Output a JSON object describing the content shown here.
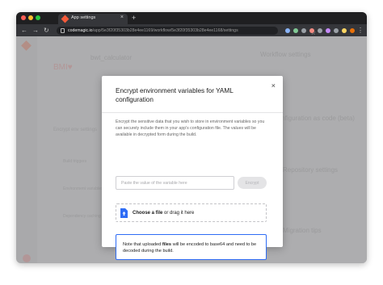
{
  "browser": {
    "tab_title": "App settings",
    "tab_close": "×",
    "new_tab": "+",
    "url_host": "codemagic.io",
    "url_path": "/app/5e3f20f35303b28e4ee1169/workflow/5e3f20f35303b28e4ee1168/settings",
    "nav": {
      "back": "←",
      "forward": "→",
      "reload": "↻"
    },
    "star": "☆",
    "menu": "⋮"
  },
  "background": {
    "app_name": "bwt_calculator",
    "workflow_settings": "Workflow settings",
    "encrypt_title": "Encrypt env settings",
    "build_triggers": "Build triggers",
    "environment": "Environment variables",
    "dependency_caching": "Dependency caching",
    "config_as_code": "Configuration as code (beta)",
    "repo_settings": "Repository settings",
    "migration_tips": "Migration tips"
  },
  "modal": {
    "title": "Encrypt environment variables for YAML configuration",
    "close": "×",
    "description": "Encrypt the sensitive data that you wish to store in environment variables so you can securely include them in your app's configuration file. The values will be available in decrypted form during the build.",
    "input_placeholder": "Paste the value of the variable here",
    "encrypt_button": "Encrypt",
    "dropzone": {
      "choose": "Choose a file",
      "rest": " or drag it here"
    },
    "note": {
      "before": "Note that uploaded ",
      "strong": "files",
      "after": " will be encoded to base64 and need to be decoded during the build."
    }
  },
  "colors": {
    "accent": "#2e6cf5",
    "brand": "#f45a3a"
  }
}
